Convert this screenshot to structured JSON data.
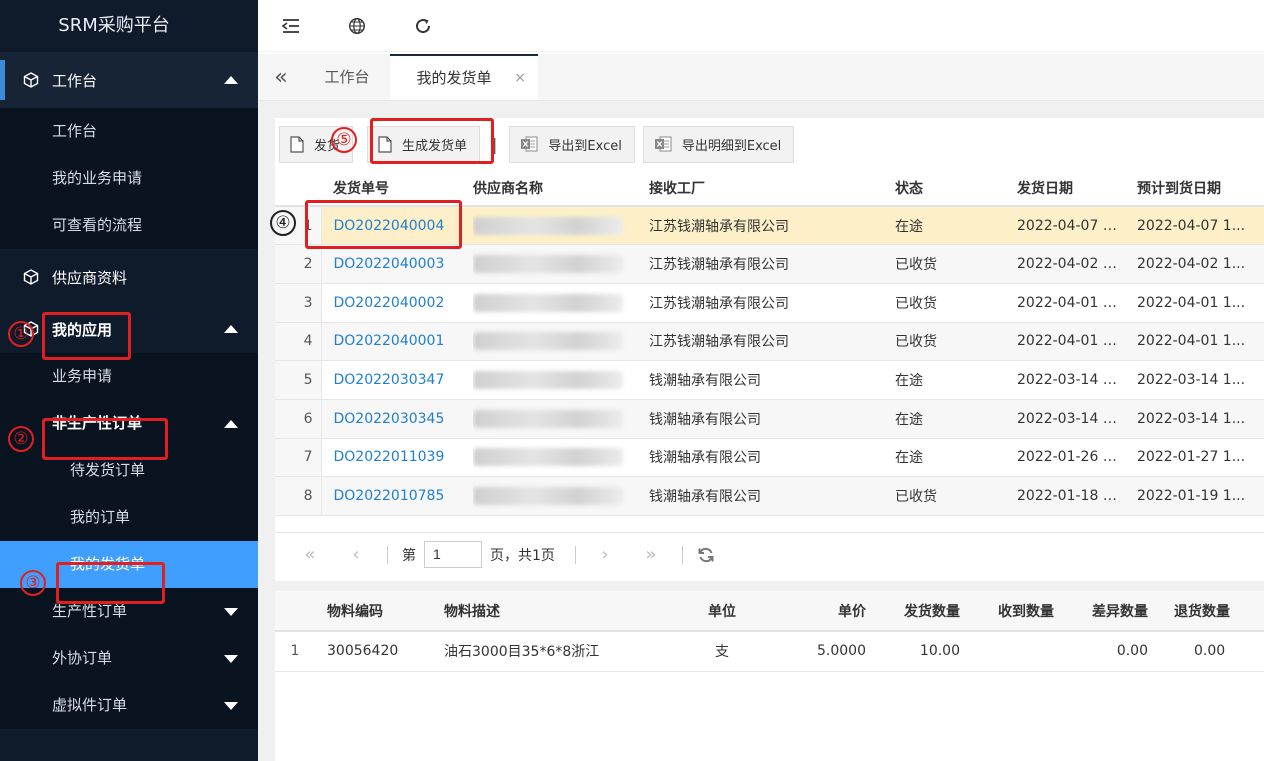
{
  "brand": "SRM采购平台",
  "sidebar": {
    "group_workbench": "工作台",
    "workbench_items": [
      "工作台",
      "我的业务申请",
      "可查看的流程"
    ],
    "group_supplier": "供应商资料",
    "group_myapps": "我的应用",
    "myapps_items": {
      "biz_apply": "业务申请",
      "nonprod_order": "非生产性订单",
      "nonprod_children": [
        "待发货订单",
        "我的订单",
        "我的发货单"
      ],
      "prod_order": "生产性订单",
      "outsource_order": "外协订单",
      "virtual_order": "虚拟件订单"
    }
  },
  "annotations": [
    "①",
    "②",
    "③",
    "④",
    "⑤"
  ],
  "tabs": {
    "workbench": "工作台",
    "my_shipments": "我的发货单",
    "close": "×"
  },
  "toolbar": {
    "ship": "发货",
    "generate": "生成发货单",
    "sep": "|",
    "export": "导出到Excel",
    "export_detail": "导出明细到Excel"
  },
  "grid": {
    "columns": [
      "发货单号",
      "供应商名称",
      "接收工厂",
      "状态",
      "发货日期",
      "预计到货日期"
    ],
    "rows": [
      {
        "n": "1",
        "code": "DO2022040004",
        "factory": "江苏钱潮轴承有限公司",
        "status": "在途",
        "ship": "2022-04-07 1...",
        "eta": "2022-04-07 1..."
      },
      {
        "n": "2",
        "code": "DO2022040003",
        "factory": "江苏钱潮轴承有限公司",
        "status": "已收货",
        "ship": "2022-04-02 1...",
        "eta": "2022-04-02 1..."
      },
      {
        "n": "3",
        "code": "DO2022040002",
        "factory": "江苏钱潮轴承有限公司",
        "status": "已收货",
        "ship": "2022-04-01 1...",
        "eta": "2022-04-01 1..."
      },
      {
        "n": "4",
        "code": "DO2022040001",
        "factory": "江苏钱潮轴承有限公司",
        "status": "已收货",
        "ship": "2022-04-01 1...",
        "eta": "2022-04-01 1..."
      },
      {
        "n": "5",
        "code": "DO2022030347",
        "factory": "钱潮轴承有限公司",
        "status": "在途",
        "ship": "2022-03-14 1...",
        "eta": "2022-03-14 1..."
      },
      {
        "n": "6",
        "code": "DO2022030345",
        "factory": "钱潮轴承有限公司",
        "status": "在途",
        "ship": "2022-03-14 1...",
        "eta": "2022-03-14 1..."
      },
      {
        "n": "7",
        "code": "DO2022011039",
        "factory": "钱潮轴承有限公司",
        "status": "在途",
        "ship": "2022-01-26 1...",
        "eta": "2022-01-27 1..."
      },
      {
        "n": "8",
        "code": "DO2022010785",
        "factory": "钱潮轴承有限公司",
        "status": "已收货",
        "ship": "2022-01-18 0...",
        "eta": "2022-01-19 1..."
      }
    ]
  },
  "pager": {
    "prefix": "第",
    "page": "1",
    "suffix": "页，共1页"
  },
  "detail": {
    "columns": [
      "物料编码",
      "物料描述",
      "单位",
      "单价",
      "发货数量",
      "收到数量",
      "差异数量",
      "退货数量"
    ],
    "rows": [
      {
        "n": "1",
        "code": "30056420",
        "desc": "油石3000目35*6*8浙江",
        "unit": "支",
        "price": "5.0000",
        "qty": "10.00",
        "recv": "",
        "diff": "0.00",
        "ret": "0.00"
      }
    ]
  },
  "colors": {
    "sidebar_bg": "#0f1a2a",
    "selected": "#409eff",
    "link": "#1f7fd1",
    "annotation": "#e02020",
    "highlight_row": "#fdf0c8"
  }
}
